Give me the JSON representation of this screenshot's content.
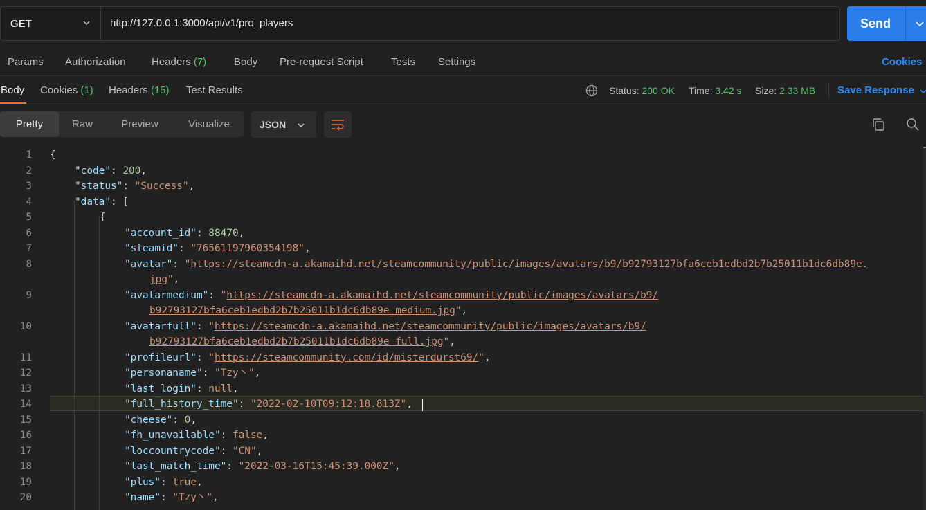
{
  "request": {
    "method": "GET",
    "url": "http://127.0.0.1:3000/api/v1/pro_players",
    "send_label": "Send"
  },
  "request_tabs": {
    "params": "Params",
    "authorization": "Authorization",
    "headers": "Headers",
    "headers_count": "(7)",
    "body": "Body",
    "prerequest": "Pre-request Script",
    "tests": "Tests",
    "settings": "Settings",
    "cookies_link": "Cookies"
  },
  "response_tabs": {
    "body": "Body",
    "cookies": "Cookies",
    "cookies_count": "(1)",
    "headers": "Headers",
    "headers_count": "(15)",
    "test_results": "Test Results"
  },
  "response_meta": {
    "status_label": "Status:",
    "status_value": "200 OK",
    "time_label": "Time:",
    "time_value": "3.42 s",
    "size_label": "Size:",
    "size_value": "2.33 MB",
    "save_response": "Save Response"
  },
  "view": {
    "modes": [
      "Pretty",
      "Raw",
      "Preview",
      "Visualize"
    ],
    "active_mode": "Pretty",
    "format": "JSON"
  },
  "icons": {
    "method_dropdown": "chevron-down-icon",
    "send_dropdown": "chevron-down-icon",
    "globe": "globe-icon",
    "format_dropdown": "chevron-down-icon",
    "wrap": "wrap-lines-icon",
    "copy": "copy-icon",
    "search": "search-icon",
    "save_dropdown": "chevron-down-icon"
  },
  "colors": {
    "accent_blue": "#2b7de9",
    "link_blue": "#2b8cf5",
    "success_green": "#4fc46a",
    "tab_underline": "#f26b3a",
    "json_key": "#9cdcfe",
    "json_string": "#ce9178",
    "json_number": "#b5cea8"
  },
  "highlighted_line": 14,
  "code_lines": [
    {
      "n": "1",
      "parts": []
    },
    {
      "n": "2",
      "parts": []
    },
    {
      "n": "3",
      "parts": []
    },
    {
      "n": "4",
      "parts": []
    },
    {
      "n": "5",
      "parts": []
    },
    {
      "n": "6",
      "parts": []
    },
    {
      "n": "7",
      "parts": []
    },
    {
      "n": "8",
      "parts": []
    },
    {
      "n": "",
      "parts": []
    },
    {
      "n": "9",
      "parts": []
    },
    {
      "n": "",
      "parts": []
    },
    {
      "n": "10",
      "parts": []
    },
    {
      "n": "",
      "parts": []
    },
    {
      "n": "11",
      "parts": []
    },
    {
      "n": "12",
      "parts": []
    },
    {
      "n": "13",
      "parts": []
    },
    {
      "n": "14",
      "parts": []
    },
    {
      "n": "15",
      "parts": []
    },
    {
      "n": "16",
      "parts": []
    },
    {
      "n": "17",
      "parts": []
    },
    {
      "n": "18",
      "parts": []
    },
    {
      "n": "19",
      "parts": []
    },
    {
      "n": "20",
      "parts": []
    }
  ],
  "json_lines": [
    [
      [
        "p",
        "{"
      ]
    ],
    [
      [
        "k",
        "\"code\""
      ],
      [
        "p",
        ": "
      ],
      [
        "n",
        "200"
      ],
      [
        "p",
        ","
      ]
    ],
    [
      [
        "k",
        "\"status\""
      ],
      [
        "p",
        ": "
      ],
      [
        "s",
        "\"Success\""
      ],
      [
        "p",
        ","
      ]
    ],
    [
      [
        "k",
        "\"data\""
      ],
      [
        "p",
        ": ["
      ]
    ],
    [
      [
        "p",
        "{"
      ]
    ],
    [
      [
        "k",
        "\"account_id\""
      ],
      [
        "p",
        ": "
      ],
      [
        "n",
        "88470"
      ],
      [
        "p",
        ","
      ]
    ],
    [
      [
        "k",
        "\"steamid\""
      ],
      [
        "p",
        ": "
      ],
      [
        "s",
        "\"76561197960354198\""
      ],
      [
        "p",
        ","
      ]
    ],
    [
      [
        "k",
        "\"avatar\""
      ],
      [
        "p",
        ": "
      ],
      [
        "s",
        "\""
      ],
      [
        "u",
        "https://steamcdn-a.akamaihd.net/steamcommunity/public/images/avatars/b9/b92793127bfa6ceb1edbd2b7b25011b1dc6db89e."
      ]
    ],
    [
      [
        "u",
        "jpg"
      ],
      [
        "s",
        "\""
      ],
      [
        "p",
        ","
      ]
    ],
    [
      [
        "k",
        "\"avatarmedium\""
      ],
      [
        "p",
        ": "
      ],
      [
        "s",
        "\""
      ],
      [
        "u",
        "https://steamcdn-a.akamaihd.net/steamcommunity/public/images/avatars/b9/"
      ]
    ],
    [
      [
        "u",
        "b92793127bfa6ceb1edbd2b7b25011b1dc6db89e_medium.jpg"
      ],
      [
        "s",
        "\""
      ],
      [
        "p",
        ","
      ]
    ],
    [
      [
        "k",
        "\"avatarfull\""
      ],
      [
        "p",
        ": "
      ],
      [
        "s",
        "\""
      ],
      [
        "u",
        "https://steamcdn-a.akamaihd.net/steamcommunity/public/images/avatars/b9/"
      ]
    ],
    [
      [
        "u",
        "b92793127bfa6ceb1edbd2b7b25011b1dc6db89e_full.jpg"
      ],
      [
        "s",
        "\""
      ],
      [
        "p",
        ","
      ]
    ],
    [
      [
        "k",
        "\"profileurl\""
      ],
      [
        "p",
        ": "
      ],
      [
        "s",
        "\""
      ],
      [
        "u",
        "https://steamcommunity.com/id/misterdurst69/"
      ],
      [
        "s",
        "\""
      ],
      [
        "p",
        ","
      ]
    ],
    [
      [
        "k",
        "\"personaname\""
      ],
      [
        "p",
        ": "
      ],
      [
        "s",
        "\"Tzy丶\""
      ],
      [
        "p",
        ","
      ]
    ],
    [
      [
        "k",
        "\"last_login\""
      ],
      [
        "p",
        ": "
      ],
      [
        "kw",
        "null"
      ],
      [
        "p",
        ","
      ]
    ],
    [
      [
        "k",
        "\"full_history_time\""
      ],
      [
        "p",
        ": "
      ],
      [
        "s",
        "\"2022-02-10T09:12:18.813Z\""
      ],
      [
        "p",
        ","
      ]
    ],
    [
      [
        "k",
        "\"cheese\""
      ],
      [
        "p",
        ": "
      ],
      [
        "n",
        "0"
      ],
      [
        "p",
        ","
      ]
    ],
    [
      [
        "k",
        "\"fh_unavailable\""
      ],
      [
        "p",
        ": "
      ],
      [
        "kw",
        "false"
      ],
      [
        "p",
        ","
      ]
    ],
    [
      [
        "k",
        "\"loccountrycode\""
      ],
      [
        "p",
        ": "
      ],
      [
        "s",
        "\"CN\""
      ],
      [
        "p",
        ","
      ]
    ],
    [
      [
        "k",
        "\"last_match_time\""
      ],
      [
        "p",
        ": "
      ],
      [
        "s",
        "\"2022-03-16T15:45:39.000Z\""
      ],
      [
        "p",
        ","
      ]
    ],
    [
      [
        "k",
        "\"plus\""
      ],
      [
        "p",
        ": "
      ],
      [
        "kw",
        "true"
      ],
      [
        "p",
        ","
      ]
    ],
    [
      [
        "k",
        "\"name\""
      ],
      [
        "p",
        ": "
      ],
      [
        "s",
        "\"Tzy丶\""
      ],
      [
        "p",
        ","
      ]
    ]
  ]
}
